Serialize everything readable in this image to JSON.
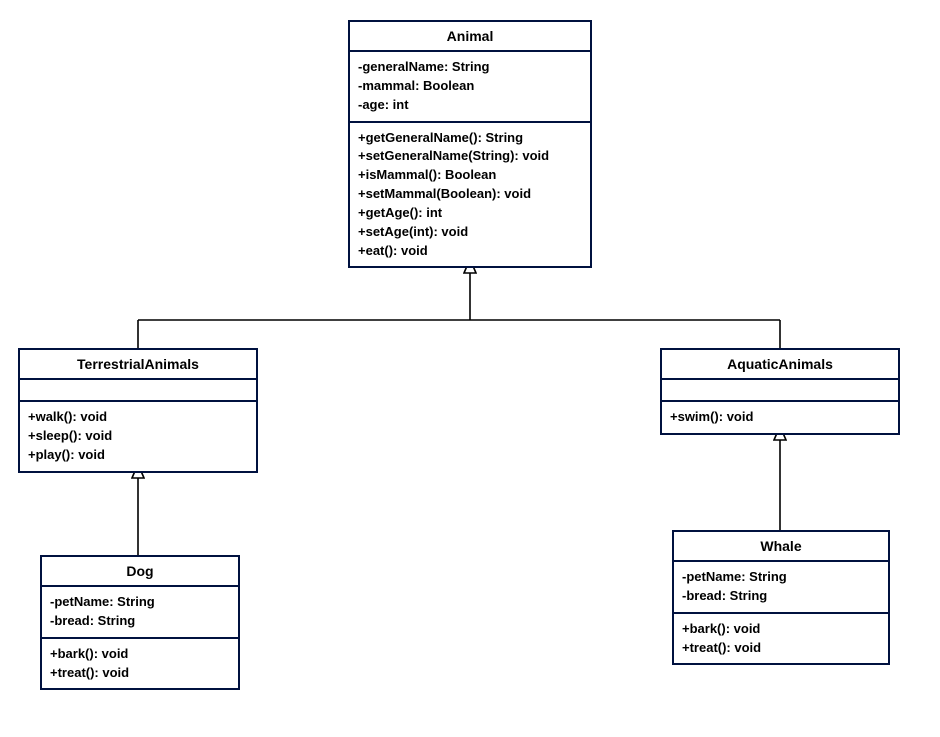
{
  "chart_data": {
    "type": "uml_class_diagram",
    "classes": [
      {
        "id": "animal",
        "name": "Animal",
        "attributes": [
          {
            "visibility": "-",
            "name": "generalName",
            "type": "String"
          },
          {
            "visibility": "-",
            "name": "mammal",
            "type": "Boolean"
          },
          {
            "visibility": "-",
            "name": "age",
            "type": "int"
          }
        ],
        "methods": [
          {
            "visibility": "+",
            "signature": "getGeneralName()",
            "return": "String"
          },
          {
            "visibility": "+",
            "signature": "setGeneralName(String)",
            "return": "void"
          },
          {
            "visibility": "+",
            "signature": "isMammal()",
            "return": "Boolean"
          },
          {
            "visibility": "+",
            "signature": "setMammal(Boolean)",
            "return": "void"
          },
          {
            "visibility": "+",
            "signature": "getAge()",
            "return": "int"
          },
          {
            "visibility": "+",
            "signature": "setAge(int)",
            "return": "void"
          },
          {
            "visibility": "+",
            "signature": "eat()",
            "return": "void"
          }
        ]
      },
      {
        "id": "terrestrial",
        "name": "TerrestrialAnimals",
        "attributes": [],
        "methods": [
          {
            "visibility": "+",
            "signature": "walk()",
            "return": "void"
          },
          {
            "visibility": "+",
            "signature": "sleep()",
            "return": "void"
          },
          {
            "visibility": "+",
            "signature": "play()",
            "return": "void"
          }
        ]
      },
      {
        "id": "aquatic",
        "name": "AquaticAnimals",
        "attributes": [],
        "methods": [
          {
            "visibility": "+",
            "signature": "swim()",
            "return": "void"
          }
        ]
      },
      {
        "id": "dog",
        "name": "Dog",
        "attributes": [
          {
            "visibility": "-",
            "name": "petName",
            "type": "String"
          },
          {
            "visibility": "-",
            "name": "bread",
            "type": "String"
          }
        ],
        "methods": [
          {
            "visibility": "+",
            "signature": "bark()",
            "return": "void"
          },
          {
            "visibility": "+",
            "signature": "treat()",
            "return": "void"
          }
        ]
      },
      {
        "id": "whale",
        "name": "Whale",
        "attributes": [
          {
            "visibility": "-",
            "name": "petName",
            "type": "String"
          },
          {
            "visibility": "-",
            "name": "bread",
            "type": "String"
          }
        ],
        "methods": [
          {
            "visibility": "+",
            "signature": "bark()",
            "return": "void"
          },
          {
            "visibility": "+",
            "signature": "treat()",
            "return": "void"
          }
        ]
      }
    ],
    "relationships": [
      {
        "type": "inheritance",
        "child": "terrestrial",
        "parent": "animal"
      },
      {
        "type": "inheritance",
        "child": "aquatic",
        "parent": "animal"
      },
      {
        "type": "inheritance",
        "child": "dog",
        "parent": "terrestrial"
      },
      {
        "type": "inheritance",
        "child": "whale",
        "parent": "aquatic"
      }
    ]
  },
  "animal": {
    "title": "Animal",
    "attrs": [
      "-generalName: String",
      "-mammal: Boolean",
      "-age: int"
    ],
    "methods": [
      "+getGeneralName(): String",
      "+setGeneralName(String): void",
      "+isMammal(): Boolean",
      "+setMammal(Boolean): void",
      "+getAge(): int",
      "+setAge(int): void",
      "+eat(): void"
    ]
  },
  "terrestrial": {
    "title": "TerrestrialAnimals",
    "methods": [
      "+walk(): void",
      "+sleep(): void",
      "+play(): void"
    ]
  },
  "aquatic": {
    "title": "AquaticAnimals",
    "methods": [
      "+swim(): void"
    ]
  },
  "dog": {
    "title": "Dog",
    "attrs": [
      "-petName: String",
      "-bread: String"
    ],
    "methods": [
      "+bark(): void",
      "+treat(): void"
    ]
  },
  "whale": {
    "title": "Whale",
    "attrs": [
      "-petName: String",
      "-bread: String"
    ],
    "methods": [
      "+bark(): void",
      "+treat(): void"
    ]
  }
}
